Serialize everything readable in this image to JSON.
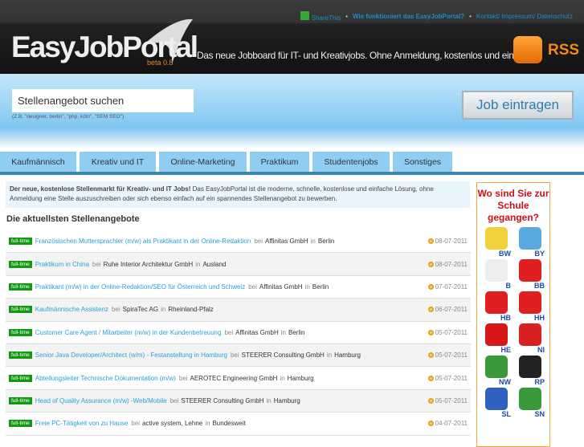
{
  "header": {
    "sharethis": "ShareThis",
    "how": "Wie funktioniert das EasyJobPortal?",
    "contact": "Kontakt/ Impressum/ Datenschutz",
    "logo": "EasyJobPortal",
    "beta": "beta 0.8",
    "tagline": "Das neue Jobboard für IT- und Kreativjobs. Ohne Anmeldung, kostenlos und einfach!",
    "rss": "RSS"
  },
  "search": {
    "value": "Stellenangebot suchen",
    "hint": "(Z.B. \"designer, berlin\", \"php, köln\", \"SEM SEO\")",
    "button": "Job eintragen"
  },
  "tabs": [
    "Kaufmännisch",
    "Kreativ und IT",
    "Online-Marketing",
    "Praktikum",
    "Studentenjobs",
    "Sonstiges"
  ],
  "intro": {
    "bold": "Der neue, kostenlose Stellenmarkt für Kreativ- und IT Jobs!",
    "text": " Das EasyJobPortal ist die moderne, schnelle, kostenlose und einfache Lösung, ohne Anmeldung eine Stelle auszuschreiben oder sich ebenso einfach auf ein spannendes Stellenangebot zu bewerben."
  },
  "heading": "Die aktuellsten Stellenangebote",
  "jobs": [
    {
      "type": "full-time",
      "title": "Französischen Muttersprachler (m/w) als Praktikant in der Online-Redaktion",
      "bei": "bei",
      "company": "Affinitas GmbH",
      "in": "in",
      "location": "Berlin",
      "date": "08-07-2011"
    },
    {
      "type": "full-time",
      "title": "Praktikum in China",
      "bei": "bei",
      "company": "Ruhe Interior Architektur GmbH",
      "in": "in",
      "location": "Ausland",
      "date": "08-07-2011"
    },
    {
      "type": "full-time",
      "title": "Praktikant (m/w) in der Online-Redaktion/SEO für Österreich und Schweiz",
      "bei": "bei",
      "company": "Affinitas GmbH",
      "in": "in",
      "location": "Berlin",
      "date": "07-07-2011"
    },
    {
      "type": "full-time",
      "title": "Kaufmännische Assistenz",
      "bei": "bei",
      "company": "SpiraTec AG",
      "in": "in",
      "location": "Rheinland-Pfalz",
      "date": "06-07-2011"
    },
    {
      "type": "full-time",
      "title": "Customer Care Agent / Mitarbeiter (m/w) in der Kundenbetreuung",
      "bei": "bei",
      "company": "Affinitas GmbH",
      "in": "in",
      "location": "Berlin",
      "date": "05-07-2011"
    },
    {
      "type": "full-time",
      "title": "Senior Java Developer/Architect (w/m) - Festanstellung in Hamburg",
      "bei": "bei",
      "company": "STEERER Consulting GmbH",
      "in": "in",
      "location": "Hamburg",
      "date": "05-07-2011"
    },
    {
      "type": "full-time",
      "title": "Abteilungsleiter Technische Dokumentation (m/w)",
      "bei": "bei",
      "company": "AEROTEC Engineering GmbH",
      "in": "in",
      "location": "Hamburg",
      "date": "05-07-2011"
    },
    {
      "type": "full-time",
      "title": "Head of Quality Assurance (m/w) -Web/Mobile",
      "bei": "bei",
      "company": "STEERER Consulting GmbH",
      "in": "in",
      "location": "Hamburg",
      "date": "05-07-2011"
    },
    {
      "type": "full-time",
      "title": "Freie PC-Tätigkeit von zu Hause",
      "bei": "bei",
      "company": "active system, Lehne",
      "in": "in",
      "location": "Bundesweit",
      "date": "04-07-2011"
    }
  ],
  "sidebar": {
    "title": "Wo sind Sie zur Schule gegangen?",
    "states": [
      {
        "abbr": "BW",
        "color": "#f2d23a"
      },
      {
        "abbr": "BY",
        "color": "#5aa8e0"
      },
      {
        "abbr": "B",
        "color": "#eeeeee"
      },
      {
        "abbr": "BB",
        "color": "#e02020"
      },
      {
        "abbr": "HB",
        "color": "#e02020"
      },
      {
        "abbr": "HH",
        "color": "#e02020"
      },
      {
        "abbr": "HE",
        "color": "#d81818"
      },
      {
        "abbr": "NI",
        "color": "#d82020"
      },
      {
        "abbr": "NW",
        "color": "#3a9a3a"
      },
      {
        "abbr": "RP",
        "color": "#222222"
      },
      {
        "abbr": "SL",
        "color": "#3060c0"
      },
      {
        "abbr": "SN",
        "color": "#3a9a3a"
      }
    ]
  }
}
